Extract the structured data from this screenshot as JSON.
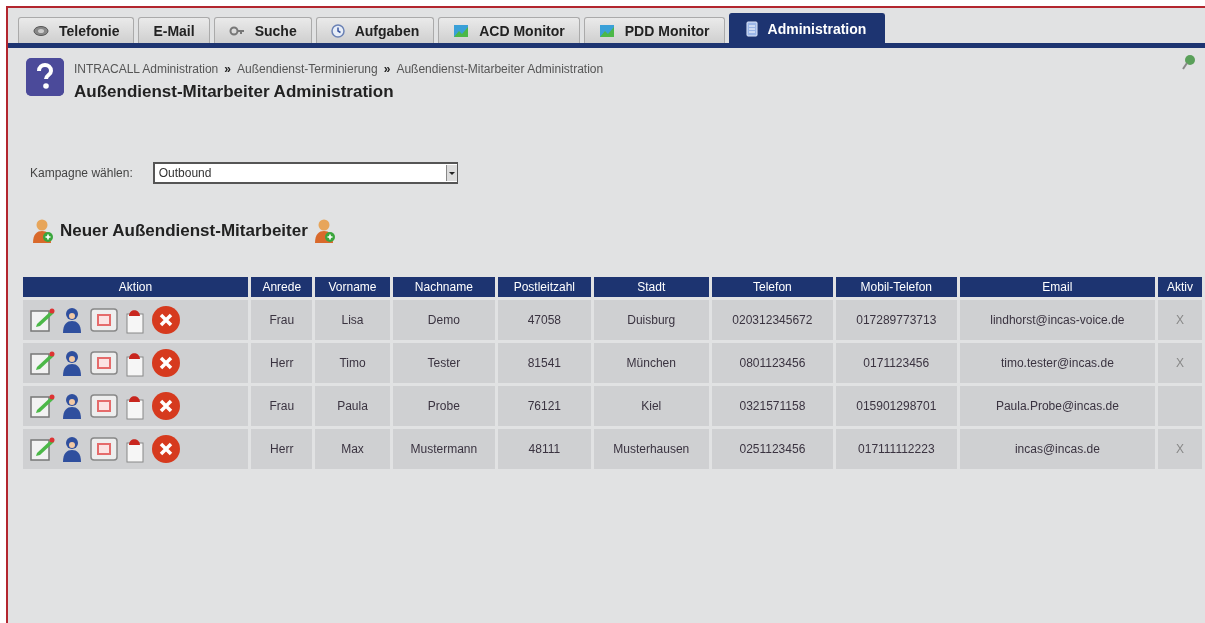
{
  "tabs": [
    {
      "label": "Telefonie",
      "kind": "phone",
      "selected": false
    },
    {
      "label": "E-Mail",
      "kind": "none",
      "selected": false
    },
    {
      "label": "Suche",
      "kind": "search",
      "selected": false
    },
    {
      "label": "Aufgaben",
      "kind": "clock",
      "selected": false
    },
    {
      "label": "ACD Monitor",
      "kind": "chart",
      "selected": false
    },
    {
      "label": "PDD Monitor",
      "kind": "chart",
      "selected": false
    },
    {
      "label": "Administration",
      "kind": "doc",
      "selected": true
    }
  ],
  "breadcrumb": [
    {
      "label": "INTRACALL Administration",
      "sep": "»"
    },
    {
      "label": "Außendienst-Terminierung",
      "sep": "»"
    },
    {
      "label": "Außendienst-Mitarbeiter Administration"
    }
  ],
  "page_title": "Außendienst-Mitarbeiter Administration",
  "campaign": {
    "label": "Kampagne wählen:",
    "value": "Outbound"
  },
  "new_employee": "Neuer Außendienst-Mitarbeiter",
  "table": {
    "columns": [
      "Aktion",
      "Anrede",
      "Vorname",
      "Nachname",
      "Postleitzahl",
      "Stadt",
      "Telefon",
      "Mobil-Telefon",
      "Email",
      "Aktiv"
    ],
    "rows": [
      {
        "cells": [
          "",
          "Frau",
          "Lisa",
          "Demo",
          "47058",
          "Duisburg",
          "020312345672",
          "017289773713",
          "lindhorst@incas-voice.de",
          "X"
        ]
      },
      {
        "cells": [
          "",
          "Herr",
          "Timo",
          "Tester",
          "81541",
          "München",
          "0801123456",
          "0171123456",
          "timo.tester@incas.de",
          "X"
        ]
      },
      {
        "cells": [
          "",
          "Frau",
          "Paula",
          "Probe",
          "76121",
          "Kiel",
          "0321571158",
          "015901298701",
          "Paula.Probe@incas.de",
          ""
        ]
      },
      {
        "cells": [
          "",
          "Herr",
          "Max",
          "Mustermann",
          "48111",
          "Musterhausen",
          "0251123456",
          "017111112223",
          "incas@incas.de",
          "X"
        ]
      }
    ]
  }
}
